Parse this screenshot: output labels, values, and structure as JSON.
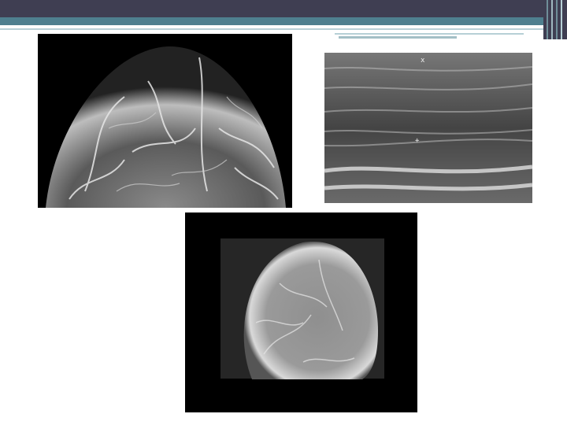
{
  "slide": {
    "images": [
      {
        "name": "mammogram-upper",
        "kind": "mammogram"
      },
      {
        "name": "breast-ultrasound",
        "kind": "ultrasound"
      },
      {
        "name": "mammogram-lower",
        "kind": "mammogram"
      }
    ]
  },
  "colors": {
    "header_dark": "#3f3e52",
    "header_teal": "#4e7f8f",
    "accent_line": "#b7d0d6",
    "background": "#ffffff"
  }
}
